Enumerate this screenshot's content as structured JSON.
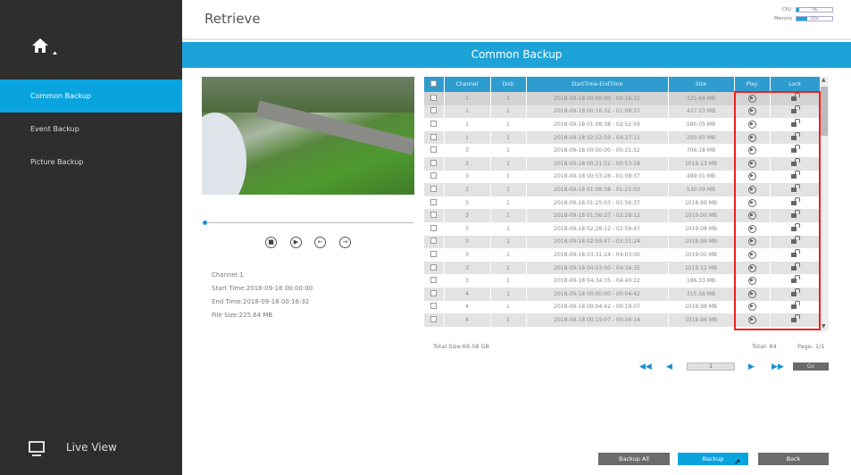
{
  "header": {
    "title": "Retrieve",
    "cpu_label": "CPU",
    "cpu_value": "7%",
    "cpu_fraction": 0.07,
    "memory_label": "Memory",
    "memory_value": "31%",
    "memory_fraction": 0.31
  },
  "sidebar": {
    "items": [
      {
        "label": "Common Backup",
        "active": true
      },
      {
        "label": "Event Backup"
      },
      {
        "label": "Picture Backup"
      }
    ],
    "live_view": "Live View"
  },
  "banner": "Common Backup",
  "player": {
    "progress": 0.0,
    "info": {
      "channel": "Channel:1",
      "start": "Start Time:2018-09-18 00:00:00",
      "end": "End Time:2018-09-18 00:16:32",
      "size": "File Size:225.64 MB"
    }
  },
  "table": {
    "headers": [
      "",
      "Channel",
      "Disk",
      "StartTime-EndTime",
      "Size",
      "Play",
      "Lock"
    ],
    "rows": [
      [
        "1",
        "1",
        "2018-09-18 00:00:00 - 00:16:32",
        "225.64 MB"
      ],
      [
        "1",
        "1",
        "2018-09-18 00:16:32 - 01:08:37",
        "437.23 MB"
      ],
      [
        "1",
        "1",
        "2018-09-18 01:08:38 - 02:52:59",
        "580.05 MB"
      ],
      [
        "1",
        "1",
        "2018-09-18 02:52:59 - 04:37:11",
        "250.60 MB"
      ],
      [
        "3",
        "1",
        "2018-09-18 00:00:00 - 00:21:52",
        "706.18 MB"
      ],
      [
        "3",
        "1",
        "2018-09-18 00:21:52 - 00:53:28",
        "1019.13 MB"
      ],
      [
        "3",
        "1",
        "2018-09-18 00:53:28 - 01:08:37",
        "489.01 MB"
      ],
      [
        "3",
        "1",
        "2018-09-18 01:08:38 - 01:25:03",
        "530.09 MB"
      ],
      [
        "3",
        "1",
        "2018-09-18 01:25:03 - 01:56:37",
        "1018.99 MB"
      ],
      [
        "3",
        "1",
        "2018-09-18 01:56:37 - 02:28:12",
        "1019.00 MB"
      ],
      [
        "3",
        "1",
        "2018-09-18 02:28:12 - 02:59:47",
        "1019.08 MB"
      ],
      [
        "3",
        "1",
        "2018-09-18 02:59:47 - 03:31:24",
        "1018.99 MB"
      ],
      [
        "3",
        "1",
        "2018-09-18 03:31:24 - 04:03:00",
        "1019.00 MB"
      ],
      [
        "3",
        "1",
        "2018-09-18 04:03:00 - 04:34:35",
        "1019.12 MB"
      ],
      [
        "3",
        "1",
        "2018-09-18 04:34:35 - 04:40:22",
        "186.33 MB"
      ],
      [
        "4",
        "1",
        "2018-09-18 00:00:00 - 00:04:42",
        "315.56 MB"
      ],
      [
        "4",
        "1",
        "2018-09-18 00:04:42 - 00:19:07",
        "1018.98 MB"
      ],
      [
        "4",
        "1",
        "2018-09-18 00:19:07 - 00:34:14",
        "1018.94 MB"
      ]
    ]
  },
  "footer": {
    "total_size": "Total Size:69.58 GB",
    "total": "Total: 84",
    "page": "Page: 1/1",
    "page_input": "1",
    "go": "Go"
  },
  "buttons": {
    "backup_all": "Backup All",
    "backup": "Backup",
    "back": "Back"
  },
  "colors": {
    "accent": "#1ea3d9",
    "sidebar": "#2e2e2e",
    "highlight": "#f0211c"
  }
}
